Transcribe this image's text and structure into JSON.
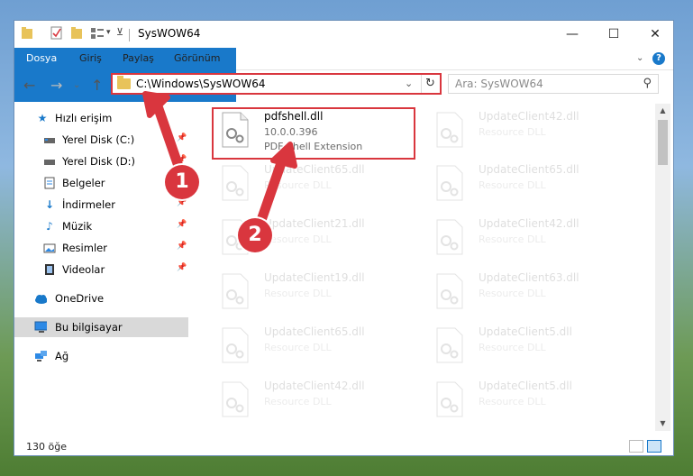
{
  "window": {
    "title": "SysWOW64",
    "controls": {
      "minimize": "—",
      "maximize": "☐",
      "close": "✕"
    }
  },
  "ribbon": {
    "tabs": [
      {
        "label": "Dosya",
        "selected": true
      },
      {
        "label": "Giriş"
      },
      {
        "label": "Paylaş"
      },
      {
        "label": "Görünüm"
      }
    ],
    "help": "?"
  },
  "address": {
    "path": "C:\\Windows\\SysWOW64",
    "refresh_glyph": "↻"
  },
  "search": {
    "placeholder": "Ara: SysWOW64"
  },
  "sidebar": {
    "items": [
      {
        "label": "Hızlı erişim",
        "icon": "star-icon"
      },
      {
        "label": "Yerel Disk (C:)",
        "icon": "drive-icon",
        "pinned": true
      },
      {
        "label": "Yerel Disk (D:)",
        "icon": "drive-icon",
        "pinned": true
      },
      {
        "label": "Belgeler",
        "icon": "documents-icon",
        "pinned": true
      },
      {
        "label": "İndirmeler",
        "icon": "download-icon",
        "pinned": true
      },
      {
        "label": "Müzik",
        "icon": "music-icon",
        "pinned": true
      },
      {
        "label": "Resimler",
        "icon": "pictures-icon",
        "pinned": true
      },
      {
        "label": "Videolar",
        "icon": "video-icon",
        "pinned": true
      },
      {
        "label": "OneDrive",
        "icon": "cloud-icon"
      },
      {
        "label": "Bu bilgisayar",
        "icon": "computer-icon",
        "selected": true
      },
      {
        "label": "Ağ",
        "icon": "network-icon"
      }
    ]
  },
  "files": {
    "highlighted": {
      "name": "pdfshell.dll",
      "version": "10.0.0.396",
      "description": "PDF Shell Extension"
    },
    "col1": [
      {
        "name": "UpdateClient65.dll",
        "description": "Resource DLL"
      },
      {
        "name": "UpdateClient21.dll",
        "description": "Resource DLL"
      },
      {
        "name": "UpdateClient19.dll",
        "description": "Resource DLL"
      },
      {
        "name": "UpdateClient65.dll",
        "description": "Resource DLL"
      },
      {
        "name": "UpdateClient42.dll",
        "description": "Resource DLL"
      }
    ],
    "col2": [
      {
        "name": "UpdateClient42.dll",
        "description": "Resource DLL"
      },
      {
        "name": "UpdateClient65.dll",
        "description": "Resource DLL"
      },
      {
        "name": "UpdateClient42.dll",
        "description": "Resource DLL"
      },
      {
        "name": "UpdateClient63.dll",
        "description": "Resource DLL"
      },
      {
        "name": "UpdateClient5.dll",
        "description": "Resource DLL"
      },
      {
        "name": "UpdateClient5.dll",
        "description": "Resource DLL"
      }
    ]
  },
  "status": {
    "item_count": "130 öğe"
  },
  "annotations": {
    "step1": "1",
    "step2": "2",
    "color": "#d9363e"
  },
  "colors": {
    "accent": "#1979ca",
    "highlight": "#d9363e"
  }
}
